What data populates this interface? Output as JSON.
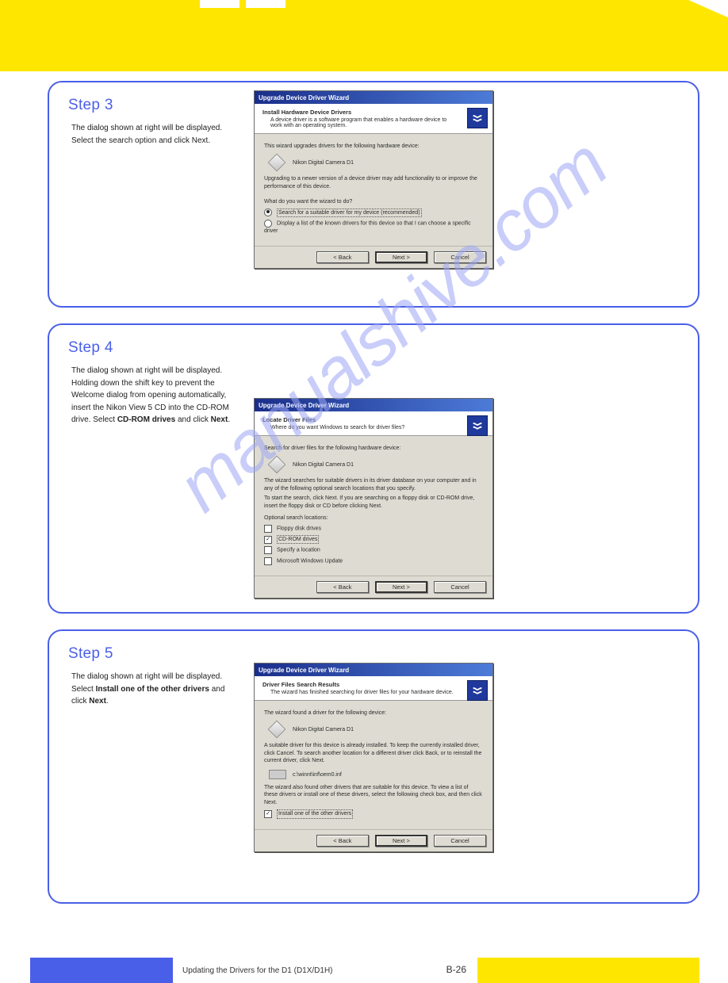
{
  "watermark": "manualshive.com",
  "footer": {
    "text": "Updating the Drivers for the D1 (D1X/D1H)",
    "page": "B-26"
  },
  "step3": {
    "title": "Step 3",
    "text": "The dialog shown at right will be displayed. Select the search option and click Next.",
    "dialog": {
      "title": "Upgrade Device Driver Wizard",
      "heading": "Install Hardware Device Drivers",
      "sub": "A device driver is a software program that enables a hardware device to work with an operating system.",
      "body1": "This wizard upgrades drivers for the following hardware device:",
      "device": "Nikon Digital Camera D1",
      "body2": "Upgrading to a newer version of a device driver may add functionality to or improve the performance of this device.",
      "question": "What do you want the wizard to do?",
      "opt1": "Search for a suitable driver for my device (recommended)",
      "opt2": "Display a list of the known drivers for this device so that I can choose a specific driver",
      "back": "< Back",
      "next": "Next >",
      "cancel": "Cancel"
    }
  },
  "step4": {
    "title": "Step 4",
    "text_parts": [
      "The dialog shown at right will be displayed. Holding down the shift key to prevent the Welcome dialog from opening automatically, insert the Nikon View 5 CD into the CD-ROM drive. Select ",
      "CD-ROM drives",
      " and click ",
      "Next",
      "."
    ],
    "dialog": {
      "title": "Upgrade Device Driver Wizard",
      "heading": "Locate Driver Files",
      "sub": "Where do you want Windows to search for driver files?",
      "body1": "Search for driver files for the following hardware device:",
      "device": "Nikon Digital Camera D1",
      "body2": "The wizard searches for suitable drivers in its driver database on your computer and in any of the following optional search locations that you specify.",
      "body3": "To start the search, click Next. If you are searching on a floppy disk or CD-ROM drive, insert the floppy disk or CD before clicking Next.",
      "optTitle": "Optional search locations:",
      "opt1": "Floppy disk drives",
      "opt2": "CD-ROM drives",
      "opt3": "Specify a location",
      "opt4": "Microsoft Windows Update",
      "back": "< Back",
      "next": "Next >",
      "cancel": "Cancel"
    }
  },
  "step5": {
    "title": "Step 5",
    "text_parts": [
      "The dialog shown at right will be displayed. Select ",
      "Install one of the other drivers",
      " and click ",
      "Next",
      "."
    ],
    "dialog": {
      "title": "Upgrade Device Driver Wizard",
      "heading": "Driver Files Search Results",
      "sub": "The wizard has finished searching for driver files for your hardware device.",
      "body1": "The wizard found a driver for the following device:",
      "device": "Nikon Digital Camera D1",
      "body2": "A suitable driver for this device is already installed. To keep the currently installed driver, click Cancel. To search another location for a different driver click Back, or to reinstall the current driver, click Next.",
      "path": "c:\\winnt\\inf\\oem0.inf",
      "body3": "The wizard also found other drivers that are suitable for this device. To view a list of these drivers or install one of these drivers, select the following check box, and then click Next.",
      "opt": "Install one of the other drivers",
      "back": "< Back",
      "next": "Next >",
      "cancel": "Cancel"
    }
  }
}
